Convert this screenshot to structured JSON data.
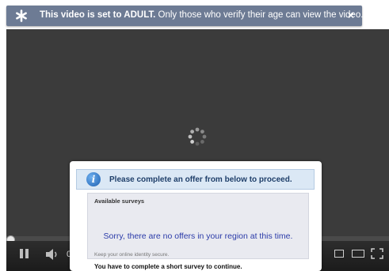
{
  "banner": {
    "icon": "star-icon",
    "bold_text": "This video is set to ADULT.",
    "text": " Only those who verify their age can view the video.",
    "close_label": "×"
  },
  "player": {
    "state": "loading",
    "time_label": "0",
    "icons": [
      "loading-spinner-icon",
      "pause-icon",
      "volume-icon",
      "small-player-icon",
      "large-player-icon",
      "fullscreen-icon"
    ]
  },
  "popup": {
    "icon": "info-icon",
    "icon_glyph": "i",
    "title": "Please complete an offer from below to proceed.",
    "surveys_label": "Available surveys",
    "no_offers_text": "Sorry, there are no offers in your region at this time.",
    "footer_note": "Keep your online identity secure.",
    "bottom_text": "You have to complete a short survey to continue."
  },
  "colors": {
    "banner_bg": "#6d7b94",
    "player_bg": "#3b3b3b",
    "popup_header_bg": "#dbe8f5",
    "link_blue": "#2a3aa8"
  }
}
